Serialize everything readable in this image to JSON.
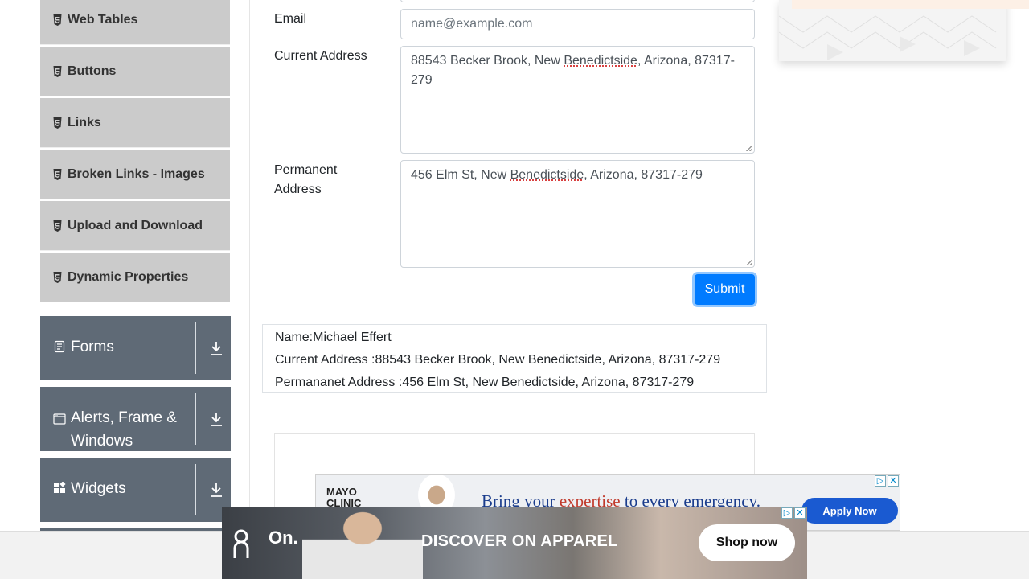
{
  "sidebar": {
    "items": [
      {
        "label": "Web Tables"
      },
      {
        "label": "Buttons"
      },
      {
        "label": "Links"
      },
      {
        "label": "Broken Links - Images"
      },
      {
        "label": "Upload and Download"
      },
      {
        "label": "Dynamic Properties"
      }
    ],
    "groups": [
      {
        "label": "Forms",
        "icon": "document-icon"
      },
      {
        "label": "Alerts, Frame & Windows",
        "icon": "window-icon"
      },
      {
        "label": "Widgets",
        "icon": "widgets-icon"
      }
    ]
  },
  "form": {
    "email_label": "Email",
    "email_placeholder": "name@example.com",
    "current_address_label": "Current Address",
    "current_address_value_1": "88543 Becker Brook, New ",
    "current_address_value_u": "Benedictside",
    "current_address_value_2": ", Arizona, 87317-279",
    "permanent_address_label": "Permanent Address",
    "permanent_address_value_1": "456 Elm St, New ",
    "permanent_address_value_u": "Benedictside",
    "permanent_address_value_2": ", Arizona, 87317-279",
    "submit_label": "Submit"
  },
  "output": {
    "name": "Name:Michael Effert",
    "current_address": "Current Address :88543 Becker Brook, New Benedictside, Arizona, 87317-279",
    "permanent_address": "Permananet Address :456 Elm St, New Benedictside, Arizona, 87317-279"
  },
  "ads": {
    "mayo_logo": "MAYO CLINIC",
    "mayo_tagline_1": "Bring your ",
    "mayo_tagline_2": "expertise",
    "mayo_tagline_3": " to every emergency.",
    "mayo_button": "Apply Now",
    "on_brand": "On.",
    "on_headline": "DISCOVER ON APPAREL",
    "on_button": "Shop now"
  },
  "colors": {
    "sidebar_item_bg": "#cbcbcb",
    "group_header_bg": "#5f6a76",
    "primary": "#007bff"
  }
}
